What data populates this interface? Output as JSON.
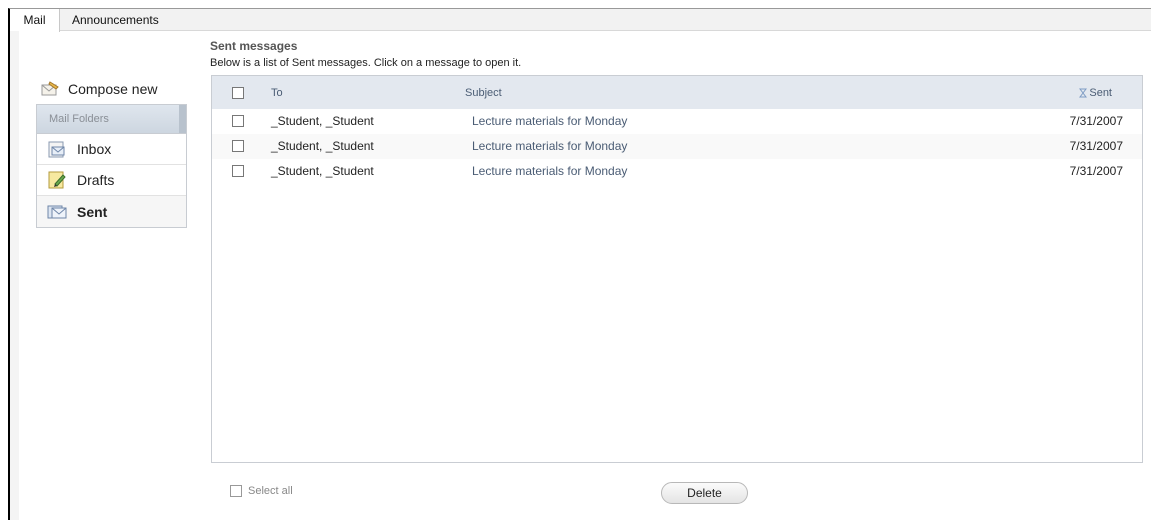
{
  "tabs": [
    {
      "label": "Mail",
      "active": true
    },
    {
      "label": "Announcements",
      "active": false
    }
  ],
  "sidebar": {
    "compose_label": "Compose new",
    "folders_header": "Mail Folders",
    "folders": [
      {
        "label": "Inbox",
        "icon": "inbox-icon"
      },
      {
        "label": "Drafts",
        "icon": "drafts-icon"
      },
      {
        "label": "Sent",
        "icon": "sent-icon",
        "active": true
      }
    ]
  },
  "main": {
    "title": "Sent messages",
    "description": "Below is a list of Sent messages. Click on a message to open it.",
    "columns": {
      "to": "To",
      "subject": "Subject",
      "sent": "Sent"
    },
    "messages": [
      {
        "to": "_Student, _Student",
        "subject": "Lecture materials for Monday",
        "sent": "7/31/2007"
      },
      {
        "to": "_Student, _Student",
        "subject": "Lecture materials for Monday",
        "sent": "7/31/2007"
      },
      {
        "to": "_Student, _Student",
        "subject": "Lecture materials for Monday",
        "sent": "7/31/2007"
      }
    ],
    "select_all_label": "Select all",
    "delete_label": "Delete"
  },
  "colors": {
    "header_bg": "#e3e8ef",
    "link": "#4a5c74",
    "sort_icon": "#7e9cc4"
  }
}
